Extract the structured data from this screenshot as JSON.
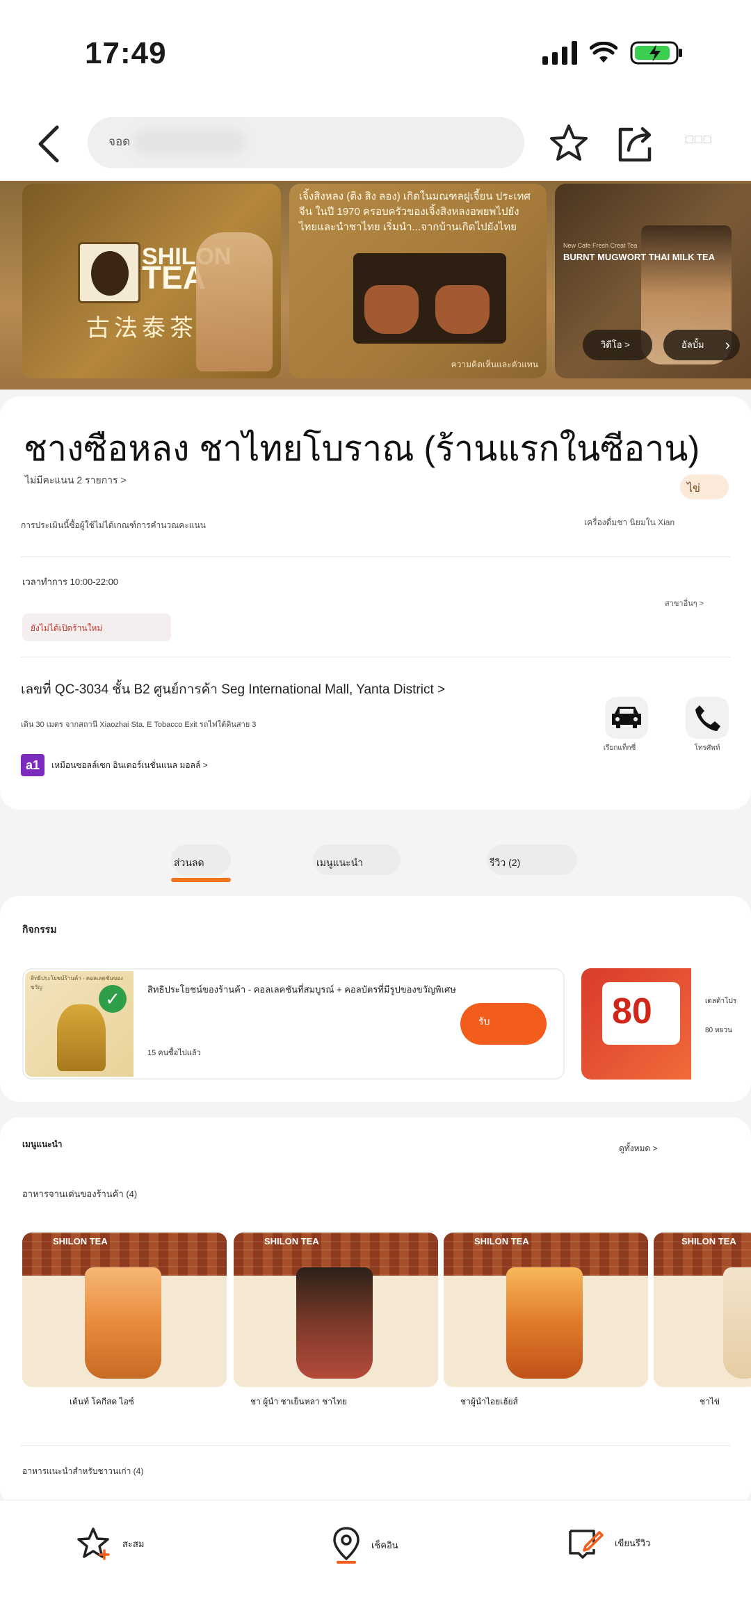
{
  "status_bar": {
    "time": "17:49"
  },
  "nav": {
    "search_text": "จอด",
    "more_text": "□□□"
  },
  "banner": {
    "card1": {
      "brand_top": "SHILON",
      "brand_bottom": "TEA",
      "chinese": "古法泰茶"
    },
    "card2": {
      "description": "เจิ้งสิงหลง (ติง สิง ลอง) เกิดในมณฑลฝูเจี้ยน ประเทศจีน ในปี 1970 ครอบครัวของเจิ้งสิงหลงอพยพไปยังไทยและนำชาไทย เริ่มนำ...จากบ้านเกิดไปยังไทย",
      "caption": "ความคิดเห็นและตัวแทน"
    },
    "card3": {
      "subtitle": "New Cafe Fresh Creat Tea",
      "title": "BURNT MUGWORT THAI MILK TEA",
      "pill1": "วิดีโอ >",
      "pill2": "อัลบั้ม"
    }
  },
  "shop": {
    "name": "ชางซือหลง ชาไทยโบราณ (ร้านแรกในซีอาน)",
    "rating_text": "ไม่มีคะแนน 2 รายการ >",
    "tag": "ไข่",
    "review_note": "การประเมินนี้ซื้อผู้ใช้ไม่ได้เกณฑ์การคำนวณคะแนน",
    "review_right": "เครื่องดื่มชา นิยมใน Xian",
    "hours": "เวลาทำการ 10:00-22:00",
    "hours_more": "สาขาอื่นๆ >",
    "status": "ยังไม่ได้เปิดร้านใหม่",
    "address": "เลขที่ QC-3034 ชั้น B2 ศูนย์การค้า Seg International Mall, Yanta District >",
    "address_sub": "เดิน 30 เมตร จากสถานี Xiaozhai Sta. E Tobacco Exit รถไฟใต้ดินสาย 3",
    "mall_text": "เหมือนซอลล์เซก อินเตอร์เนชั่นแนล มอลล์ >",
    "mall_icon": "a1",
    "action_taxi": "เรียกแท็กซี่",
    "action_call": "โทรศัพท์"
  },
  "tabs": [
    {
      "label": "ส่วนลด",
      "active": true
    },
    {
      "label": "เมนูแนะนำ",
      "active": false
    },
    {
      "label": "รีวิว (2)",
      "active": false
    }
  ],
  "activity": {
    "title": "กิจกรรม",
    "coupon1": {
      "title": "สิทธิประโยชน์ของร้านค้า - คอลเลคชันที่สมบูรณ์ + คอลบัตรที่มีรูปของขวัญพิเศษ",
      "sub": "15 คนซื้อไปแล้ว",
      "button": "รับ",
      "img_caption": "สิทธิประโยชน์ร้านค้า - คอลเลคชันของขวัญ"
    },
    "coupon2": {
      "amount": "80",
      "line1": "เดลต้าโปร",
      "line2": "80 หยวน"
    }
  },
  "menu": {
    "title": "เมนูแนะนำ",
    "more": "ดูทั้งหมด >",
    "subtitle": "อาหารจานเด่นของร้านค้า (4)",
    "products": [
      {
        "name": "เต้นท์ โคกีสด ไอซ์",
        "logo": "SHILON TEA"
      },
      {
        "name": "ชา ผู้นำ ชาเย็นหลา ชาไทย",
        "logo": "SHILON TEA"
      },
      {
        "name": "ชาผู้นำไอยเฮ้ยส์",
        "logo": "SHILON TEA"
      },
      {
        "name": "ชาไข่",
        "logo": "SHILON TEA"
      }
    ],
    "subtitle2": "อาหารแนะนำสำหรับชาวนเก่า (4)"
  },
  "bottom_bar": {
    "favorite": "สะสม",
    "checkin": "เช็คอิน",
    "review": "เขียนรีวิว"
  },
  "colors": {
    "accent": "#f25d1c",
    "brand_brown": "#8e3a1e",
    "mall_purple": "#7b2cbf"
  }
}
